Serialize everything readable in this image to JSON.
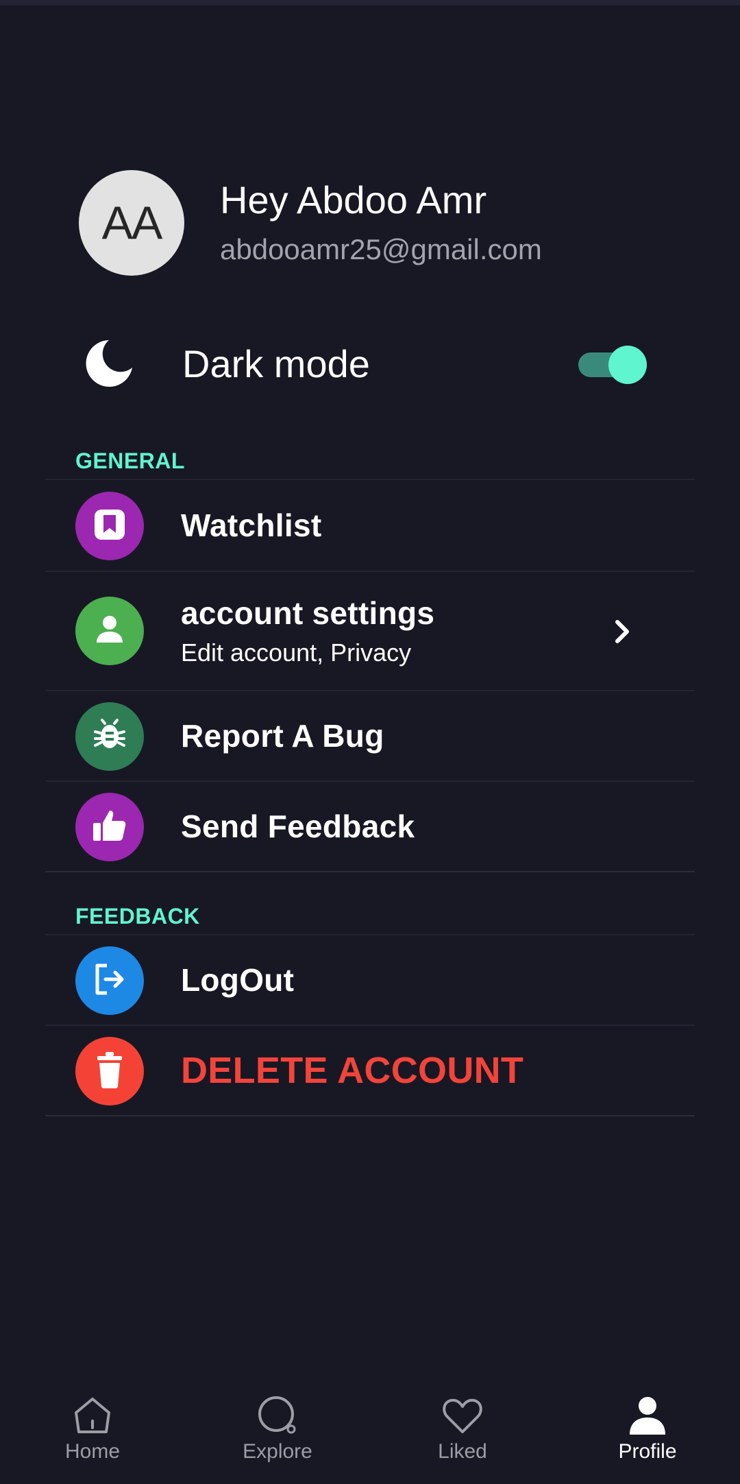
{
  "profile": {
    "initials": "AA",
    "greeting": "Hey Abdoo Amr",
    "email": "abdooamr25@gmail.com"
  },
  "darkmode": {
    "label": "Dark mode",
    "enabled": true,
    "icon": "moon-icon"
  },
  "sections": {
    "general_title": "GENERAL",
    "feedback_title": "FEEDBACK"
  },
  "general_items": [
    {
      "label": "Watchlist",
      "icon": "bookmark-icon",
      "color": "#9c27b0"
    },
    {
      "label": "account settings",
      "sublabel": "Edit account, Privacy",
      "icon": "person-icon",
      "color": "#4caf50"
    },
    {
      "label": "Report A Bug",
      "icon": "bug-icon",
      "color": "#2e7d55"
    },
    {
      "label": "Send Feedback",
      "icon": "thumbs-up-icon",
      "color": "#9c27b0"
    }
  ],
  "feedback_items": [
    {
      "label": "LogOut",
      "icon": "logout-icon",
      "color": "#1e88e5"
    },
    {
      "label": "DELETE ACCOUNT",
      "icon": "trash-icon",
      "color": "#f44336",
      "text_color": "#f2443a"
    }
  ],
  "nav": {
    "items": [
      {
        "label": "Home",
        "icon": "home-icon"
      },
      {
        "label": "Explore",
        "icon": "explore-icon"
      },
      {
        "label": "Liked",
        "icon": "heart-icon"
      },
      {
        "label": "Profile",
        "icon": "profile-icon",
        "active": true
      }
    ]
  },
  "colors": {
    "background": "#181824",
    "accent": "#5ff5cf",
    "danger": "#f2443a"
  }
}
